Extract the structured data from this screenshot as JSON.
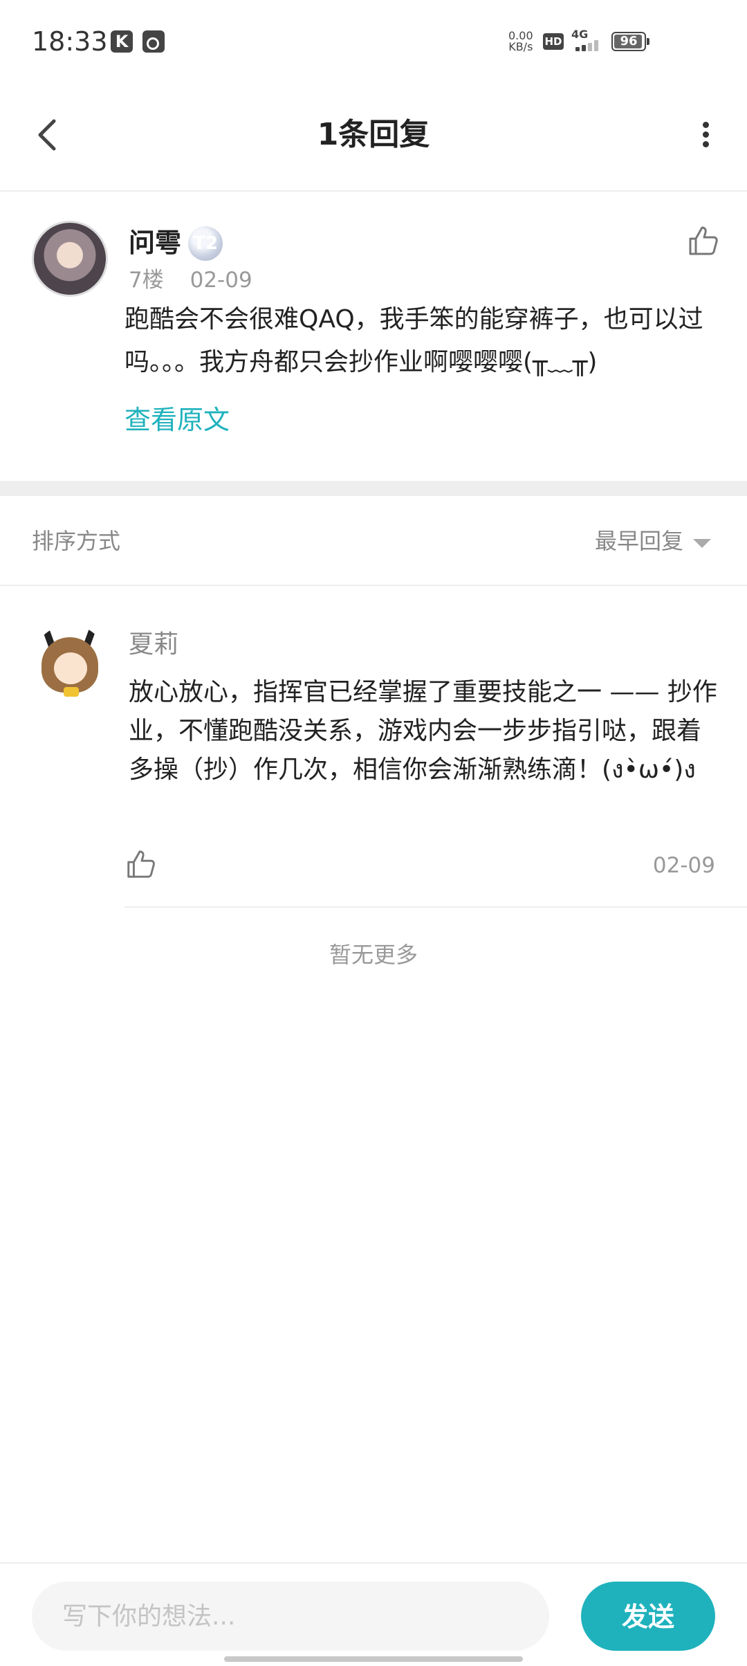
{
  "status_bar": {
    "time": "18:33",
    "app_icon_1": "K",
    "net_speed_value": "0.00",
    "net_speed_unit": "KB/s",
    "hd": "HD",
    "network": "4G",
    "battery": "96",
    "battery_level": 0.96
  },
  "header": {
    "title": "1条回复",
    "back_icon": "chevron-left-icon",
    "more_icon": "more-vertical-icon"
  },
  "post": {
    "username": "问雩",
    "badge": "T2",
    "floor": "7楼",
    "date": "02-09",
    "text": "跑酷会不会很难QAQ，我手笨的能穿裤子，也可以过吗。。。我方舟都只会抄作业啊嘤嘤嘤(╥﹏╥)",
    "view_original": "查看原文",
    "like_icon": "thumbs-up-icon"
  },
  "sort": {
    "label": "排序方式",
    "selected": "最早回复"
  },
  "reply": {
    "username": "夏莉",
    "text": "放心放心，指挥官已经掌握了重要技能之一 —— 抄作业，不懂跑酷没关系，游戏内会一步步指引哒，跟着多操（抄）作几次，相信你会渐渐熟练滴！(ง•̀ω•́)ง",
    "date": "02-09",
    "like_icon": "thumbs-up-icon"
  },
  "footer": {
    "no_more": "暂无更多"
  },
  "input_bar": {
    "placeholder": "写下你的想法...",
    "send_label": "发送"
  },
  "colors": {
    "accent": "#1fb2bd",
    "text_primary": "#222222",
    "text_secondary": "#999999",
    "divider": "#eeeeee"
  }
}
